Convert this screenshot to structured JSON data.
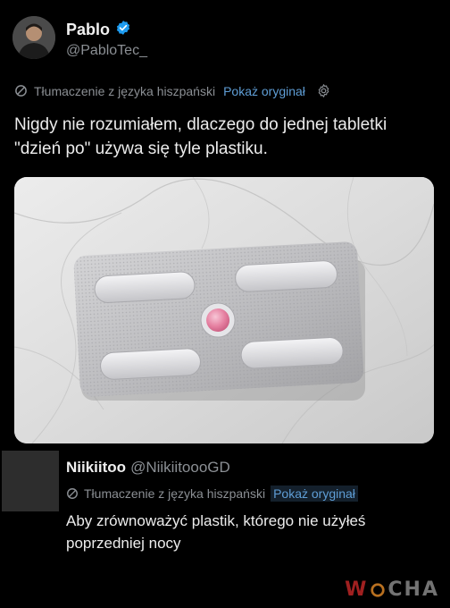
{
  "author": {
    "display_name": "Pablo",
    "handle": "@PabloTec_",
    "verified_icon": "verified-badge-icon",
    "verified_color": "#1d9bf0"
  },
  "translation": {
    "label": "Tłumaczenie z języka hiszpański",
    "show_original": "Pokaż oryginał",
    "settings_icon": "gear-icon"
  },
  "tweet": {
    "text": "Nigdy nie rozumiałem, dlaczego do jednej tabletki \"dzień po\" używa się tyle plastiku."
  },
  "reply": {
    "display_name": "Niikiitoo",
    "handle": "@NiikiitoooGD",
    "translation_label": "Tłumaczenie z języka hiszpański",
    "show_original": "Pokaż oryginał",
    "text": "Aby zrównoważyć plastik, którego nie użyłeś poprzedniej nocy"
  },
  "watermark": {
    "prefix": "W",
    "rest": "CHA"
  },
  "colors": {
    "background": "#000000",
    "text": "#e7e9ea",
    "secondary": "#8b8f94",
    "link": "#5f9ed6",
    "pill": "#e57fa0"
  }
}
